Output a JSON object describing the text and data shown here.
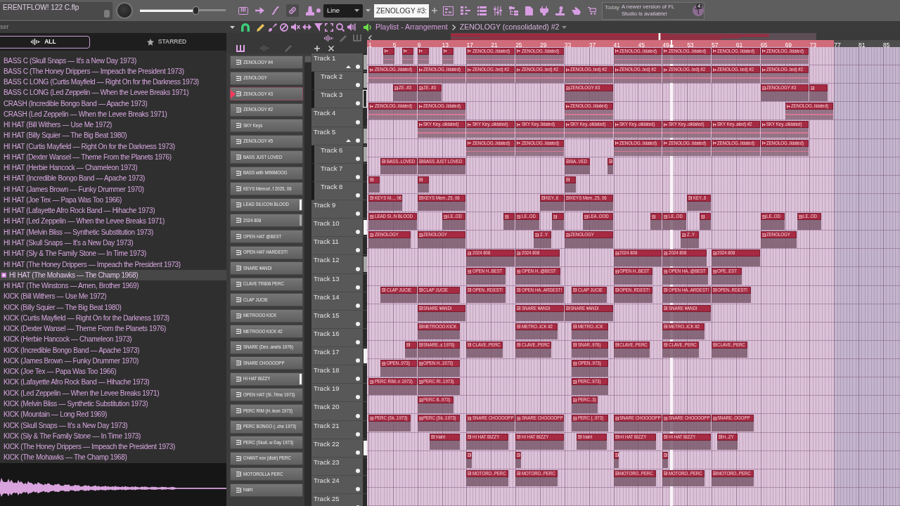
{
  "top_bar": {
    "project_title": "ERENTFLOW! 122 C.flp",
    "master_volume": {
      "level": 0.65
    },
    "snap_mode": "Line",
    "pattern_field": "ZENOLOGY #3:",
    "notification": {
      "time": "Today",
      "message": "A newer version of FL Studio is available!",
      "count": "4"
    }
  },
  "browser": {
    "title": "ser",
    "tabs": [
      {
        "label": "ALL",
        "selected": true
      },
      {
        "label": "STARRED",
        "selected": false
      }
    ],
    "items": [
      {
        "label": "BASS C (Skull Snaps — It's a New Day 1973)",
        "selected": false
      },
      {
        "label": "BASS C (The Honey Drippers — Impeach the President 1973)",
        "selected": false
      },
      {
        "label": "BASS C LONG (Curtis Mayfield — Right On for the Darkness 1973)",
        "selected": false
      },
      {
        "label": "BASS C LONG (Led Zeppelin — When the Levee Breaks 1971)",
        "selected": false
      },
      {
        "label": "CRASH (Incredible Bongo Band — Apache 1973)",
        "selected": false
      },
      {
        "label": "CRASH (Led Zeppelin — When the Levee Breaks 1971)",
        "selected": false
      },
      {
        "label": "HI HAT (Bill Withers — Use Me 1972)",
        "selected": false
      },
      {
        "label": "HI HAT (Billy Squier — The Big Beat 1980)",
        "selected": false
      },
      {
        "label": "HI HAT (Curtis Mayfield — Right On for the Darkness 1973)",
        "selected": false
      },
      {
        "label": "HI HAT (Dexter Wansel — Theme From the Planets 1976)",
        "selected": false
      },
      {
        "label": "HI HAT (Herbie Hancock — Chameleon 1973)",
        "selected": false
      },
      {
        "label": "HI HAT (Incredible Bongo Band — Apache 1973)",
        "selected": false
      },
      {
        "label": "HI HAT (James Brown — Funky Drummer 1970)",
        "selected": false
      },
      {
        "label": "HI HAT (Joe Tex — Papa Was Too 1966)",
        "selected": false
      },
      {
        "label": "HI HAT (Lafayette Afro Rock Band — Hihache 1973)",
        "selected": false
      },
      {
        "label": "HI HAT (Led Zeppelin — When the Levee Breaks 1971)",
        "selected": false
      },
      {
        "label": "HI HAT (Melvin Bliss — Synthetic Substitution 1973)",
        "selected": false
      },
      {
        "label": "HI HAT (Skull Snaps — It's a New Day 1973)",
        "selected": false
      },
      {
        "label": "HI HAT (Sly & The Family Stone — In Time 1973)",
        "selected": false
      },
      {
        "label": "HI HAT (The Honey Drippers — Impeach the President 1973)",
        "selected": false
      },
      {
        "label": "HI HAT (The Mohawks — The Champ 1968)",
        "selected": true
      },
      {
        "label": "HI HAT (The Winstons — Amen, Brother 1969)",
        "selected": false
      },
      {
        "label": "KICK (Bill Withers — Use Me 1972)",
        "selected": false
      },
      {
        "label": "KICK (Billy Squier — The Big Beat 1980)",
        "selected": false
      },
      {
        "label": "KICK (Curtis Mayfield — Right On for the Darkness 1973)",
        "selected": false
      },
      {
        "label": "KICK (Dexter Wansel — Theme From the Planets 1976)",
        "selected": false
      },
      {
        "label": "KICK (Herbie Hancock — Chameleon 1973)",
        "selected": false
      },
      {
        "label": "KICK (Incredible Bongo Band — Apache 1973)",
        "selected": false
      },
      {
        "label": "KICK (James Brown — Funky Drummer 1970)",
        "selected": false
      },
      {
        "label": "KICK (Joe Tex — Papa Was Too 1966)",
        "selected": false
      },
      {
        "label": "KICK (Lafayette Afro Rock Band — Hihache 1973)",
        "selected": false
      },
      {
        "label": "KICK (Led Zeppelin — When the Levee Breaks 1971)",
        "selected": false
      },
      {
        "label": "KICK (Melvin Bliss — Synthetic Substitution 1973)",
        "selected": false
      },
      {
        "label": "KICK (Mountain — Long Red 1969)",
        "selected": false
      },
      {
        "label": "KICK (Skull Snaps — It's a New Day 1973)",
        "selected": false
      },
      {
        "label": "KICK (Sly & The Family Stone — In Time 1973)",
        "selected": false
      },
      {
        "label": "KICK (The Honey Drippers — Impeach the President 1973)",
        "selected": false
      },
      {
        "label": "KICK (The Mohawks — The Champ 1968)",
        "selected": false
      }
    ]
  },
  "channels": [
    {
      "name": "ZENOLOGY #4",
      "selected": false
    },
    {
      "name": "ZENOLOGY",
      "selected": false
    },
    {
      "name": "ZENOLOGY #3",
      "selected": true
    },
    {
      "name": "ZENOLOGY #2",
      "selected": false
    },
    {
      "name": "SKY Keys",
      "selected": false
    },
    {
      "name": "ZENOLOGY #5",
      "selected": false
    },
    {
      "name": "BASS JUST LOVED",
      "selected": false
    },
    {
      "name": "BASS with MINIMOOG",
      "selected": false
    },
    {
      "name": "KEYS Memori..f 2025, 06",
      "selected": false
    },
    {
      "name": "LEAD SILICON BLOOD",
      "selected": false,
      "color": "#f4f4f4"
    },
    {
      "name": "2024 808",
      "selected": false,
      "color": "#a8a8a8"
    },
    {
      "name": "OPEN HAT @BEST",
      "selected": false
    },
    {
      "name": "OPEN HAT HARDEST!",
      "selected": false
    },
    {
      "name": "SNARE ¥ANDI",
      "selected": false
    },
    {
      "name": "CLAVE TR808 PERC",
      "selected": false
    },
    {
      "name": "CLAP JUCIE",
      "selected": false
    },
    {
      "name": "METROOO KICK",
      "selected": false
    },
    {
      "name": "METROOO KICK #2",
      "selected": false
    },
    {
      "name": "SNARE (Dex..anets 1976)",
      "selected": false
    },
    {
      "name": "SNARE CHOOOOPP",
      "selected": false
    },
    {
      "name": "HI HAT BIZZY",
      "selected": false,
      "color": "#f4f4f4"
    },
    {
      "name": "OPEN HAT (Sl..Time 1973)",
      "selected": false
    },
    {
      "name": "PERC RIM (H..leon 1973)",
      "selected": false
    },
    {
      "name": "PERC BONGO (..che 1973)",
      "selected": false
    },
    {
      "name": "PERC (Skull..w Day 1973)",
      "selected": false
    },
    {
      "name": "CHANT vox (distr) PERC",
      "selected": false
    },
    {
      "name": "MOTOROLLA PERC",
      "selected": false
    },
    {
      "name": "hiaht",
      "selected": false
    }
  ],
  "playlist": {
    "title": "Playlist - Arrangement",
    "pattern": "ZENOLOGY (consolidated) #2",
    "ruler": [
      "1",
      "5",
      "9",
      "13",
      "17",
      "21",
      "25",
      "29",
      "33",
      "37",
      "41",
      "45",
      "49",
      "53",
      "57",
      "61",
      "65",
      "69",
      "73",
      "77",
      "81",
      "85"
    ],
    "song_position": {
      "level": 0.57
    },
    "tracks": [
      {
        "name": "Track 1",
        "selected": false,
        "color": "#a8a8a8",
        "clips": [
          {
            "kind": "audio"
          },
          {
            "kind": "audio"
          },
          {
            "kind": "audio"
          },
          {
            "kind": "audio"
          },
          {
            "kind": "audio",
            "label": "ZENOLOG..lidated)"
          },
          {
            "kind": "audio",
            "label": "ZENOLOG..lidated)"
          },
          {
            "kind": "audio",
            "label": "ZENOLOG..lidated)"
          },
          {
            "kind": "audio",
            "label": "ZENOLOG..lidated)"
          },
          {
            "kind": "audio",
            "label": "ZENOLOG..lidated)"
          },
          {
            "kind": "audio",
            "label": "ZENOLOG..lidated)"
          }
        ],
        "children": [
          {
            "name": "Track 2",
            "selected": false,
            "color": "#a8a8a8",
            "clips": [
              {
                "kind": "audio",
                "label": "ZENOLOG..lidated)"
              },
              {
                "kind": "audio",
                "label": "ZENOLOG..lidated)"
              },
              {
                "kind": "audio",
                "label": "ZENOLOG..ted) #2"
              },
              {
                "kind": "audio",
                "label": "ZENOLOG..ted) #2"
              },
              {
                "kind": "audio",
                "label": "ZENOLOG..ted) #2"
              },
              {
                "kind": "audio",
                "label": "ZENOLOG..ted) #2"
              },
              {
                "kind": "audio",
                "label": "ZENOLOG..ted) #2"
              },
              {
                "kind": "audio",
                "label": "ZENOLOG..ted) #2"
              },
              {
                "kind": "audio",
                "label": "ZENOLOG..ted) #2"
              }
            ]
          },
          {
            "name": "Track 3",
            "selected": true,
            "clips": [
              {
                "kind": "pattern",
                "label": "ZE..#3"
              },
              {
                "kind": "pattern",
                "label": "ZE..#3"
              },
              {
                "kind": "pattern",
                "label": "ZENOLOGY #3"
              },
              {
                "kind": "pattern",
                "label": "ZENOLOGY #3"
              },
              {
                "kind": "pattern"
              }
            ]
          }
        ]
      },
      {
        "name": "Track 4",
        "selected": false,
        "clips": [
          {
            "kind": "audio",
            "label": "ZENOLOG..lidated)"
          },
          {
            "kind": "audio",
            "label": "ZENOLOG..lidated)"
          },
          {
            "kind": "audio",
            "label": "ZENOLOG..lidated)"
          },
          {
            "kind": "audio",
            "label": "ZENOLOG..lidated)"
          }
        ]
      },
      {
        "name": "Track 5",
        "selected": false,
        "color": "#a8a8a8",
        "clips": [
          {
            "kind": "audio",
            "label": "SKY Key..olidated)"
          },
          {
            "kind": "audio",
            "label": "SKY Key..olidated)"
          },
          {
            "kind": "audio",
            "label": "SKY Key..lidated)"
          },
          {
            "kind": "audio",
            "label": "SKY Key..olidated)"
          },
          {
            "kind": "audio",
            "label": "SKY Key..olidated)"
          },
          {
            "kind": "audio",
            "label": "SKY Key..olidated)"
          },
          {
            "kind": "audio",
            "label": "SKY Key..ated) #2"
          },
          {
            "kind": "audio",
            "label": "SKY Key..olidated)"
          }
        ],
        "children": [
          {
            "name": "Track 6",
            "selected": false,
            "color": "#a8a8a8",
            "clips": [
              {
                "kind": "audio",
                "label": "ZENOLOG..lidated)"
              },
              {
                "kind": "audio",
                "label": "ZENOLOG..lidated)"
              },
              {
                "kind": "audio",
                "label": "ZENOLOG..lidated)"
              },
              {
                "kind": "audio",
                "label": "ZENOLOG..lidated)"
              },
              {
                "kind": "audio",
                "label": "ZENOLOG..lidated)"
              },
              {
                "kind": "audio",
                "label": "ZENOLOG..lidated)"
              }
            ]
          },
          {
            "name": "Track 7",
            "selected": false,
            "clips": [
              {
                "kind": "pattern",
                "label": "BASS..LOVED"
              },
              {
                "kind": "pattern",
                "label": "BASS JUST LOVED"
              },
              {
                "kind": "pattern",
                "label": "BA..VED"
              },
              {
                "kind": "pattern"
              }
            ]
          },
          {
            "name": "Track 8",
            "selected": false,
            "clips": [
              {
                "kind": "pattern"
              },
              {
                "kind": "pattern"
              },
              {
                "kind": "pattern"
              }
            ]
          }
        ]
      },
      {
        "name": "Track 9",
        "selected": false,
        "clips": [
          {
            "kind": "pattern",
            "label": "KEYS M..., 06"
          },
          {
            "kind": "pattern",
            "label": "KEYS Mem..25, 06"
          },
          {
            "kind": "pattern",
            "label": "KEY..6"
          },
          {
            "kind": "pattern",
            "label": "KEYS Mem..25, 06"
          },
          {
            "kind": "pattern",
            "label": "KEY..6"
          }
        ]
      },
      {
        "name": "Track 10",
        "selected": false,
        "color": "#f4f4f4",
        "clips": [
          {
            "kind": "pattern",
            "label": "LEAD SI..N BLOOD"
          },
          {
            "kind": "pattern",
            "label": "LE..OD"
          },
          {
            "kind": "pattern"
          },
          {
            "kind": "pattern",
            "label": "LE..OD"
          },
          {
            "kind": "pattern"
          },
          {
            "kind": "pattern",
            "label": "LEA..OOD"
          },
          {
            "kind": "pattern"
          },
          {
            "kind": "pattern",
            "label": "LE..OD"
          },
          {
            "kind": "pattern"
          },
          {
            "kind": "pattern",
            "label": "LE..OD"
          },
          {
            "kind": "pattern",
            "label": "LE..OD"
          }
        ]
      },
      {
        "name": "Track 11",
        "selected": false,
        "clips": [
          {
            "kind": "pattern",
            "label": "ZENOLOGY"
          },
          {
            "kind": "pattern",
            "label": "ZENOLOGY"
          },
          {
            "kind": "pattern",
            "label": "Z..Y"
          },
          {
            "kind": "pattern",
            "label": "ZENOLOGY"
          },
          {
            "kind": "pattern",
            "label": "Z..Y"
          },
          {
            "kind": "pattern",
            "label": "ZENOLOGY"
          }
        ]
      },
      {
        "name": "Track 12",
        "selected": false,
        "color": "#a8a8a8",
        "clips": [
          {
            "kind": "pattern",
            "label": "2024 808"
          },
          {
            "kind": "pattern",
            "label": "2024 808"
          },
          {
            "kind": "pattern",
            "label": "2024 808"
          },
          {
            "kind": "pattern",
            "label": "2024 808"
          },
          {
            "kind": "pattern",
            "label": "2024 808"
          }
        ]
      },
      {
        "name": "Track 13",
        "selected": false,
        "clips": [
          {
            "kind": "pattern",
            "label": "OPEN H..BEST"
          },
          {
            "kind": "pattern",
            "label": "OPEN H..@BEST"
          },
          {
            "kind": "pattern",
            "label": "OPEN H..BEST"
          },
          {
            "kind": "pattern",
            "label": "OPEN HA..@BEST"
          },
          {
            "kind": "pattern",
            "label": "OPE..EST"
          }
        ]
      },
      {
        "name": "Track 14",
        "selected": false,
        "clips": [
          {
            "kind": "pattern",
            "label": "CLAP JUCIE"
          },
          {
            "kind": "pattern",
            "label": "CLAP JUCIE"
          },
          {
            "kind": "pattern",
            "label": "OPEN..RDEST!"
          },
          {
            "kind": "pattern",
            "label": "OPEN HA..ARDEST!"
          },
          {
            "kind": "pattern",
            "label": "CLAP JUCIE"
          },
          {
            "kind": "pattern",
            "label": "OPEN..RDEST!"
          },
          {
            "kind": "pattern",
            "label": "OPEN HA..ARDEST!"
          },
          {
            "kind": "pattern",
            "label": "OPEN..RDEST!"
          }
        ]
      },
      {
        "name": "Track 15",
        "selected": false,
        "clips": [
          {
            "kind": "pattern",
            "label": "SNARE ¥ANDI"
          },
          {
            "kind": "pattern",
            "label": "SNARE ¥ANDI"
          },
          {
            "kind": "pattern",
            "label": "SNARE ¥ANDI"
          },
          {
            "kind": "pattern",
            "label": "SNARE ¥ANDI"
          }
        ]
      },
      {
        "name": "Track 16",
        "selected": false,
        "clips": [
          {
            "kind": "pattern",
            "label": "METROOO KICK"
          },
          {
            "kind": "pattern",
            "label": "METRO..ICK #2"
          },
          {
            "kind": "pattern",
            "label": "METRO..ICK"
          },
          {
            "kind": "pattern",
            "label": "METRO..ICK #2"
          }
        ]
      },
      {
        "name": "Track 17",
        "selected": false,
        "color": "#f4f4f4",
        "clips": [
          {
            "kind": "pattern"
          },
          {
            "kind": "pattern",
            "label": "SNARE..s 1976)"
          },
          {
            "kind": "pattern",
            "label": "CLAVE..PERC"
          },
          {
            "kind": "pattern",
            "label": "CLAVE..PERC"
          },
          {
            "kind": "pattern",
            "label": "SNAR..976)"
          },
          {
            "kind": "pattern",
            "label": "CLAVE..PERC"
          },
          {
            "kind": "pattern",
            "label": "CLAVE..PERC"
          },
          {
            "kind": "pattern",
            "label": "CLAVE..PERC"
          }
        ]
      },
      {
        "name": "Track 18",
        "selected": false,
        "clips": [
          {
            "kind": "pattern",
            "label": "OPEN..973)"
          },
          {
            "kind": "pattern",
            "label": "OPEN H..1973)"
          },
          {
            "kind": "pattern",
            "label": "OPEN..973)"
          }
        ]
      },
      {
        "name": "Track 19",
        "selected": false,
        "clips": [
          {
            "kind": "pattern",
            "label": "PERC RIM..n 1973)"
          },
          {
            "kind": "pattern",
            "label": "PERC RI..1973)"
          },
          {
            "kind": "pattern",
            "label": "PERC..973)"
          }
        ]
      },
      {
        "name": "Track 20",
        "selected": false,
        "clips": [
          {
            "kind": "pattern",
            "label": "PERC B..973)"
          },
          {
            "kind": "pattern",
            "label": "PERC..3)"
          }
        ]
      },
      {
        "name": "Track 21",
        "selected": false,
        "clips": [
          {
            "kind": "pattern",
            "label": "PERC (Sk..1973)"
          },
          {
            "kind": "pattern",
            "label": "PERC (Sk..1973)"
          },
          {
            "kind": "pattern",
            "label": "SNARE CHOOOOPP"
          },
          {
            "kind": "pattern",
            "label": "SNARE CHOOOOPP"
          },
          {
            "kind": "pattern",
            "label": "PERC (..973)"
          },
          {
            "kind": "pattern",
            "label": "SNARE CHOOOOPP"
          },
          {
            "kind": "pattern",
            "label": "SNARE CHOOOOPP"
          },
          {
            "kind": "pattern",
            "label": "SNARE..OOOPP"
          }
        ]
      },
      {
        "name": "Track 22",
        "selected": false,
        "color": "#f4f4f4",
        "clips": [
          {
            "kind": "pattern",
            "label": "hiaht"
          },
          {
            "kind": "pattern",
            "label": "HI HAT BIZZY"
          },
          {
            "kind": "pattern",
            "label": "HI HAT BIZZY"
          },
          {
            "kind": "pattern",
            "label": "hiaht"
          },
          {
            "kind": "pattern",
            "label": "HI HAT BIZZY"
          },
          {
            "kind": "pattern",
            "label": "HI HAT BIZZY"
          },
          {
            "kind": "pattern",
            "label": "H..ZY"
          }
        ]
      },
      {
        "name": "Track 23",
        "selected": false,
        "clips": [
          {
            "kind": "pattern"
          },
          {
            "kind": "pattern"
          },
          {
            "kind": "pattern"
          },
          {
            "kind": "pattern"
          }
        ]
      },
      {
        "name": "Track 24",
        "selected": false,
        "clips": [
          {
            "kind": "pattern",
            "label": "MOTORO..PERC"
          },
          {
            "kind": "pattern",
            "label": "MOTORO..PERC"
          },
          {
            "kind": "pattern",
            "label": "MOTORO..PERC"
          },
          {
            "kind": "pattern",
            "label": "MOTORO..PERC"
          },
          {
            "kind": "pattern",
            "label": "MOTORO..PERC"
          }
        ]
      },
      {
        "name": "Track 25",
        "selected": false
      }
    ]
  }
}
